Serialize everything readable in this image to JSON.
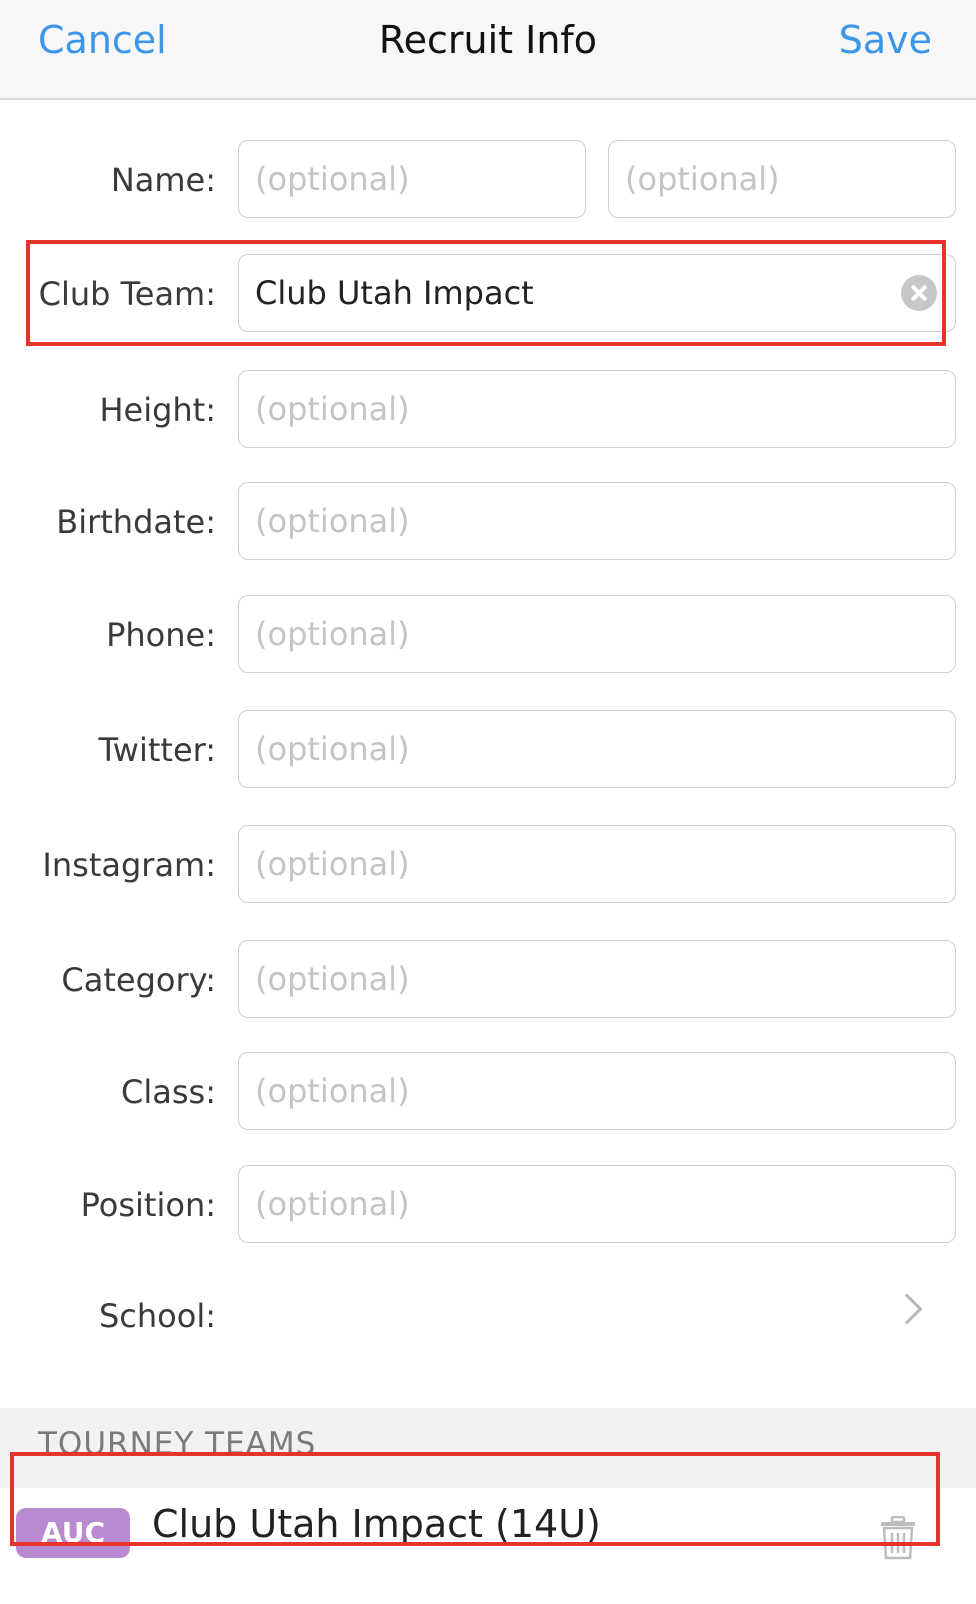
{
  "navbar": {
    "cancel": "Cancel",
    "title": "Recruit Info",
    "save": "Save"
  },
  "form": {
    "name": {
      "label": "Name:",
      "first_placeholder": "(optional)",
      "second_placeholder": "(optional)"
    },
    "club_team": {
      "label": "Club Team:",
      "value": "Club Utah Impact"
    },
    "height": {
      "label": "Height:",
      "placeholder": "(optional)"
    },
    "birthdate": {
      "label": "Birthdate:",
      "placeholder": "(optional)"
    },
    "phone": {
      "label": "Phone:",
      "placeholder": "(optional)"
    },
    "twitter": {
      "label": "Twitter:",
      "placeholder": "(optional)"
    },
    "instagram": {
      "label": "Instagram:",
      "placeholder": "(optional)"
    },
    "category": {
      "label": "Category:",
      "placeholder": "(optional)"
    },
    "class": {
      "label": "Class:",
      "placeholder": "(optional)"
    },
    "position": {
      "label": "Position:",
      "placeholder": "(optional)"
    },
    "school": {
      "label": "School:"
    }
  },
  "tourney_teams": {
    "header": "TOURNEY TEAMS",
    "items": [
      {
        "badge": "AUC",
        "name": "Club Utah Impact (14U)"
      }
    ]
  },
  "colors": {
    "accent": "#3d95e8",
    "highlight": "#e8322e",
    "badge": "#b98ad0"
  }
}
